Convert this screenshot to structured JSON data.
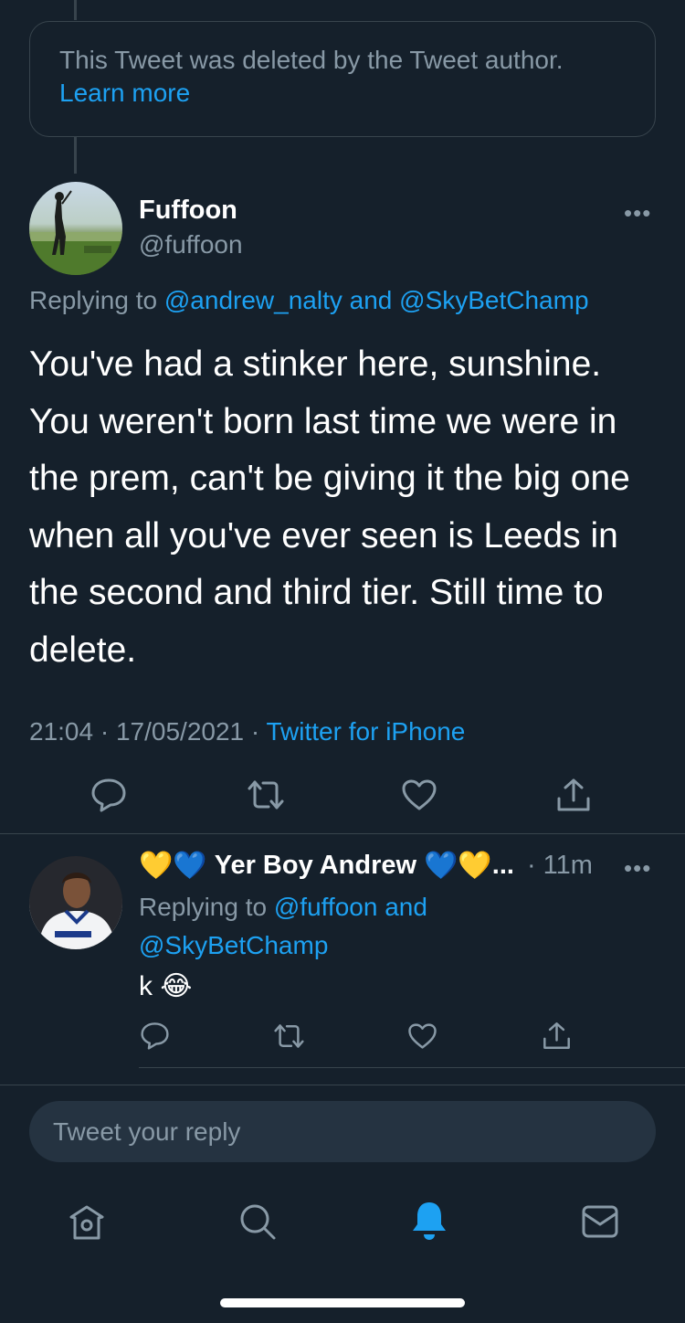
{
  "deleted_notice": {
    "text": "This Tweet was deleted by the Tweet author.",
    "learn_more": "Learn more"
  },
  "main_tweet": {
    "name": "Fuffoon",
    "handle": "@fuffoon",
    "replying_prefix": "Replying to",
    "replying_user_1": "@andrew_nalty",
    "replying_and": "and",
    "replying_user_2": "@SkyBetChamp",
    "text": "You've had a stinker here, sunshine. You weren't born last time we were in the prem, can't be giving it the big one when all you've ever seen is Leeds in the second and third tier. Still time to delete.",
    "time": "21:04",
    "sep": "·",
    "date": "17/05/2021",
    "source": "Twitter for iPhone",
    "more": "•••"
  },
  "reply_tweet": {
    "name": "Yer Boy Andrew",
    "emoji_yellow_heart": "💛",
    "emoji_blue_heart": "💙",
    "ellipsis": "...",
    "time": "· 11m",
    "replying_prefix": "Replying to",
    "replying_user_1": "@fuffoon",
    "replying_and": "and",
    "replying_user_2": "@SkyBetChamp",
    "text": "k",
    "emoji_laugh": "😂",
    "more": "•••"
  },
  "composer": {
    "placeholder": "Tweet your reply"
  },
  "tab_bar": {
    "items": [
      "home-icon",
      "search-icon",
      "notifications-icon",
      "messages-icon"
    ],
    "active": "notifications-icon"
  },
  "colors": {
    "background": "#15202b",
    "accent": "#1da1f2",
    "secondary_text": "#8899a6",
    "divider": "#38444d"
  }
}
